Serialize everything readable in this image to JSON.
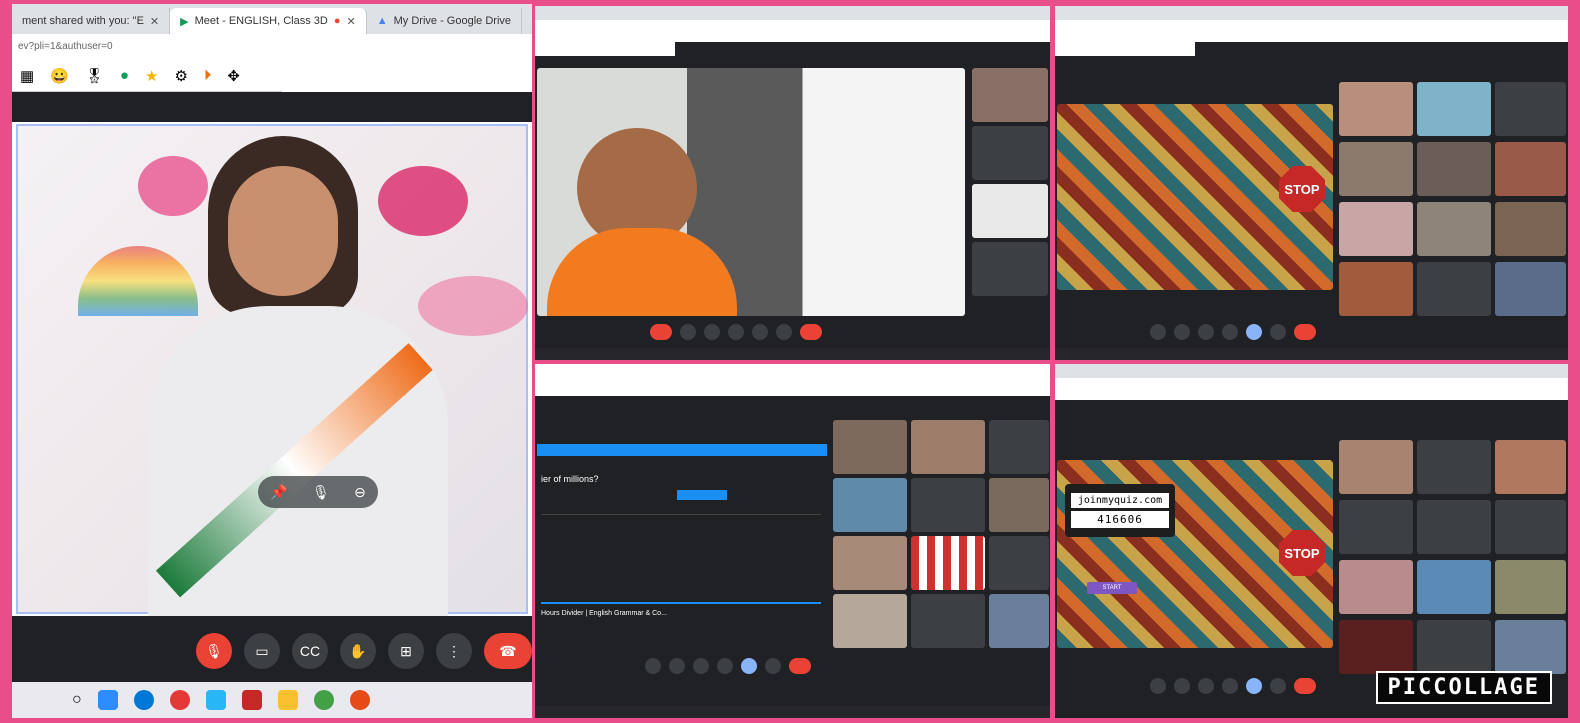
{
  "panel1": {
    "tabs": [
      {
        "label": "ment shared with you: \"E",
        "close": "✕"
      },
      {
        "label": "Meet - ENGLISH, Class 3D",
        "close": "✕"
      },
      {
        "label": "My Drive - Google Drive",
        "close": ""
      }
    ],
    "url": "ev?pli=1&authuser=0"
  },
  "panel4": {
    "quiz_question": "ier of millions?",
    "quiz_footer": "Hours Divider | English Grammar & Co..."
  },
  "panel5": {
    "join_url": "joinmyquiz.com",
    "join_code": "416606",
    "start_label": "START"
  },
  "stop_sign": "STOP",
  "watermark": "PICCOLLAGE"
}
